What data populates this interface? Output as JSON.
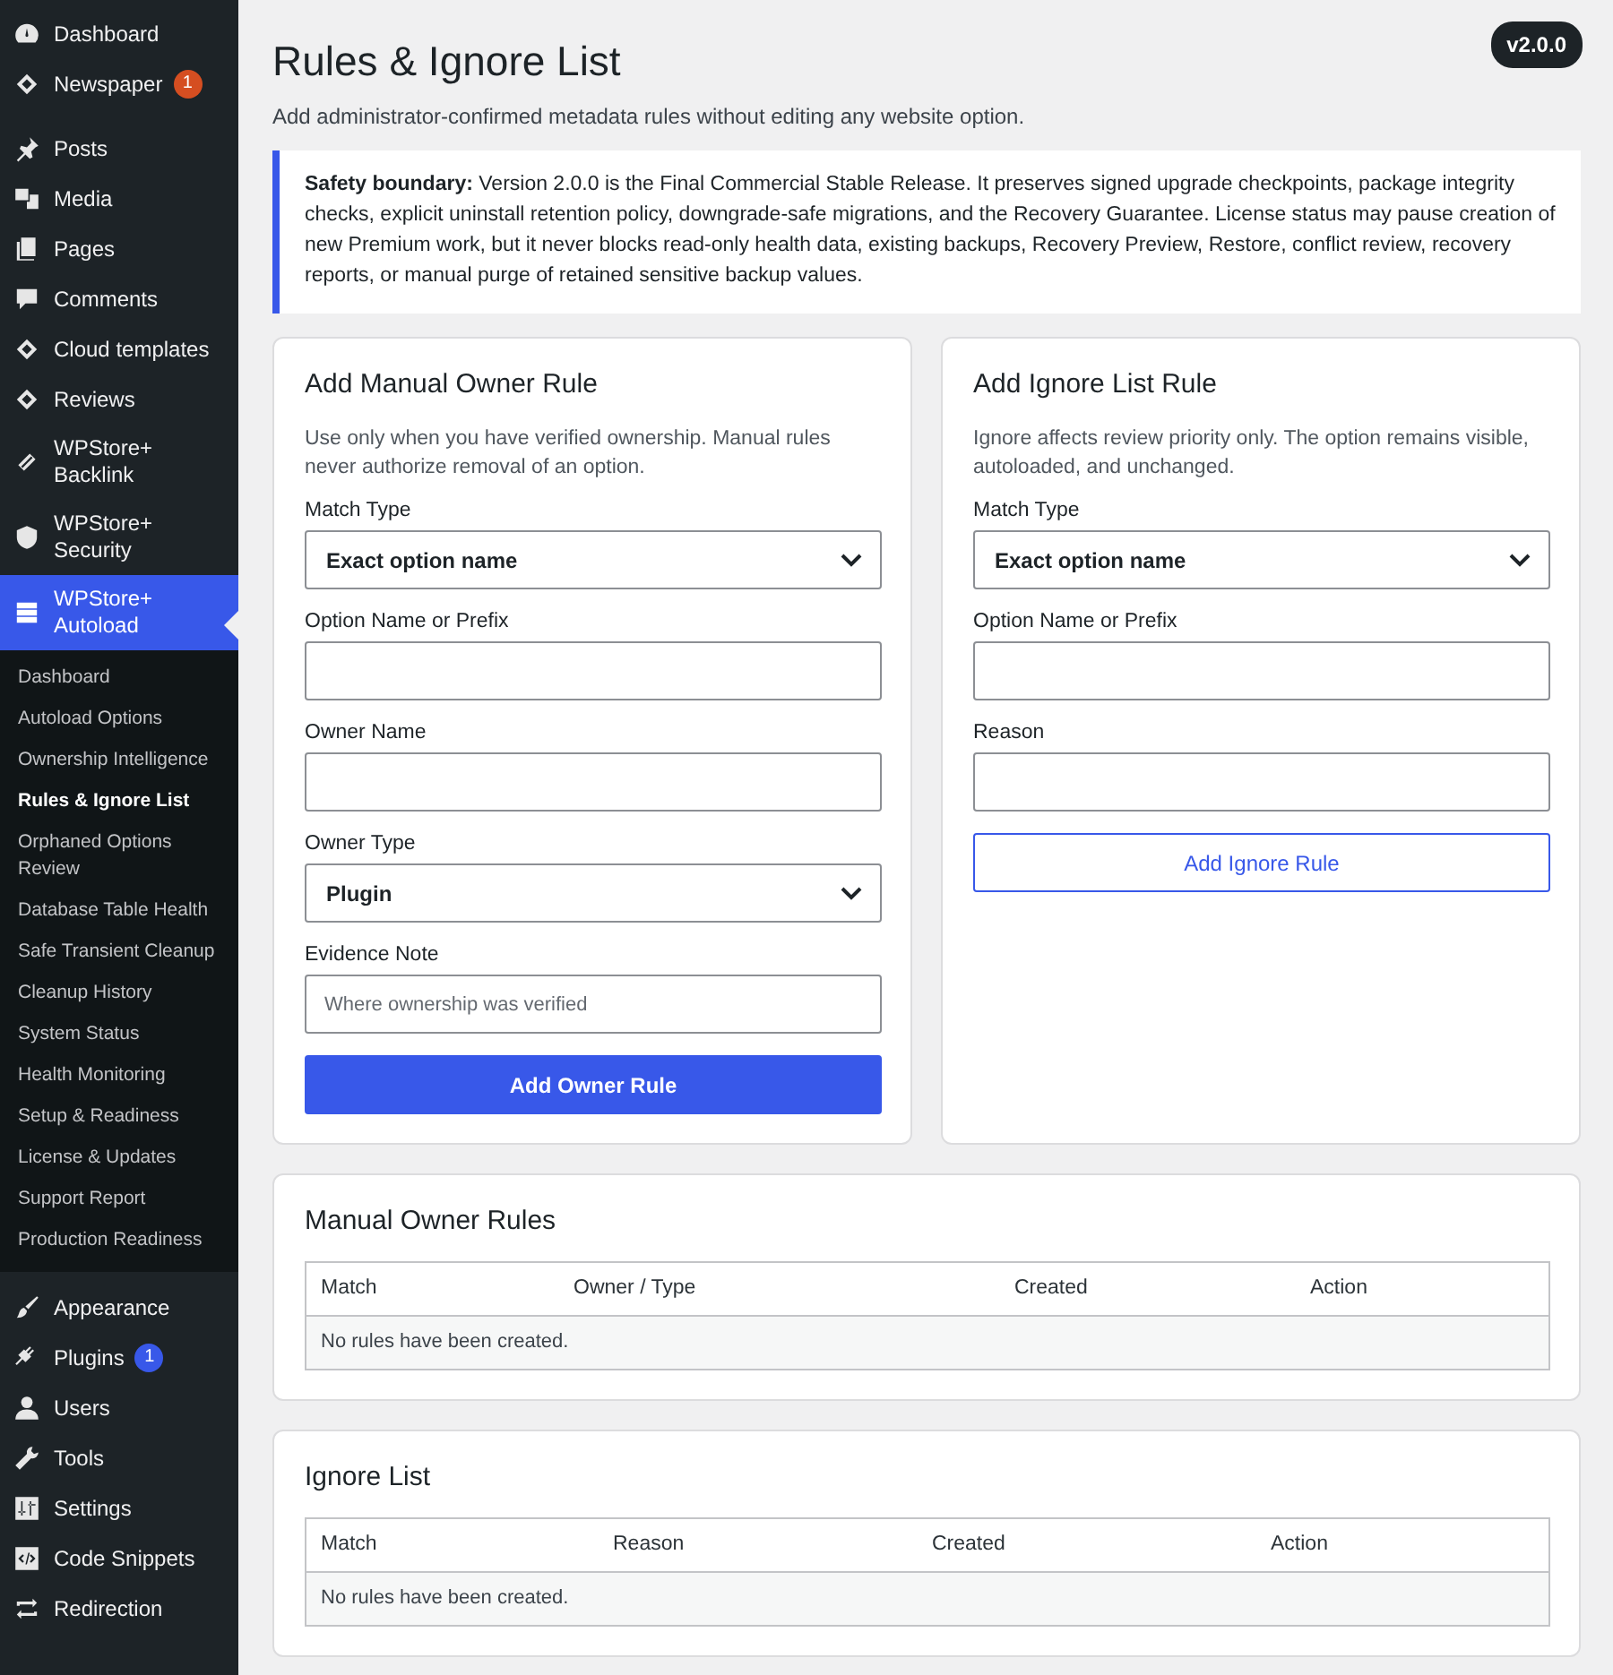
{
  "sidebar": {
    "groups": [
      {
        "menu": [
          {
            "label": "Dashboard",
            "selected": false
          },
          {
            "label": "Newspaper",
            "selected": false,
            "badge": {
              "text": "1",
              "color": "#d54e21"
            }
          }
        ]
      },
      {
        "menu": [
          {
            "label": "Posts",
            "selected": false
          },
          {
            "label": "Media",
            "selected": false
          },
          {
            "label": "Pages",
            "selected": false
          },
          {
            "label": "Comments",
            "selected": false
          },
          {
            "label": "Cloud templates",
            "selected": false
          },
          {
            "label": "Reviews",
            "selected": false
          },
          {
            "label": "WPStore+ Backlink",
            "selected": false
          },
          {
            "label": "WPStore+ Security",
            "selected": false
          },
          {
            "label": "WPStore+ Autoload",
            "selected": true,
            "children": [
              {
                "label": "Dashboard",
                "selected": false
              },
              {
                "label": "Autoload Options",
                "selected": false
              },
              {
                "label": "Ownership Intelligence",
                "selected": false
              },
              {
                "label": "Rules & Ignore List",
                "selected": true
              },
              {
                "label": "Orphaned Options Review",
                "selected": false
              },
              {
                "label": "Database Table Health",
                "selected": false
              },
              {
                "label": "Safe Transient Cleanup",
                "selected": false
              },
              {
                "label": "Cleanup History",
                "selected": false
              },
              {
                "label": "System Status",
                "selected": false
              },
              {
                "label": "Health Monitoring",
                "selected": false
              },
              {
                "label": "Setup & Readiness",
                "selected": false
              },
              {
                "label": "License & Updates",
                "selected": false
              },
              {
                "label": "Support Report",
                "selected": false
              },
              {
                "label": "Production Readiness",
                "selected": false
              }
            ]
          },
          {
            "label": "Appearance",
            "selected": false
          },
          {
            "label": "Plugins",
            "selected": false,
            "badge": {
              "text": "1",
              "color": "#3858e9"
            }
          },
          {
            "label": "Users",
            "selected": false
          },
          {
            "label": "Tools",
            "selected": false
          },
          {
            "label": "Settings",
            "selected": false
          },
          {
            "label": "Code Snippets",
            "selected": false
          },
          {
            "label": "Redirection",
            "selected": false
          }
        ]
      }
    ]
  },
  "page": {
    "title": "Rules & Ignore List",
    "version": "v2.0.0",
    "subtitle": "Add administrator-confirmed metadata rules without editing any website option.",
    "notice": "**Safety boundary:** Version 2.0.0 is the Final Commercial Stable Release. It preserves signed upgrade checkpoints, package integrity checks, explicit uninstall retention policy, downgrade-safe migrations, and the Recovery Guarantee. License status may pause creation of new Premium work, but it never blocks read-only health data, existing backups, Recovery Preview, Restore, conflict review, recovery reports, or manual purge of retained sensitive backup values."
  },
  "forms": [
    {
      "title": "Add Manual Owner Rule",
      "description": "Use only when you have verified ownership. Manual rules never authorize removal of an option.",
      "fields": [
        {
          "label": "Match Type",
          "kind": "select",
          "value": "Exact option name"
        },
        {
          "label": "Option Name or Prefix",
          "kind": "text"
        },
        {
          "label": "Owner Name",
          "kind": "text"
        },
        {
          "label": "Owner Type",
          "kind": "select",
          "value": "Plugin"
        },
        {
          "label": "Evidence Note",
          "kind": "text",
          "placeholder": "Where ownership was verified"
        }
      ],
      "button": {
        "label": "Add Owner Rule",
        "kind": "primary"
      }
    },
    {
      "title": "Add Ignore List Rule",
      "description": "Ignore affects review priority only. The option remains visible, autoloaded, and unchanged.",
      "fields": [
        {
          "label": "Match Type",
          "kind": "select",
          "value": "Exact option name"
        },
        {
          "label": "Option Name or Prefix",
          "kind": "text"
        },
        {
          "label": "Reason",
          "kind": "text"
        }
      ],
      "button": {
        "label": "Add Ignore Rule",
        "kind": "secondary"
      }
    }
  ],
  "tables": [
    {
      "title": "Manual Owner Rules",
      "columns": [
        "Match",
        "Owner / Type",
        "Created",
        "Action"
      ],
      "empty": "No rules have been created."
    },
    {
      "title": "Ignore List",
      "columns": [
        "Match",
        "Reason",
        "Created",
        "Action"
      ],
      "empty": "No rules have been created."
    }
  ]
}
